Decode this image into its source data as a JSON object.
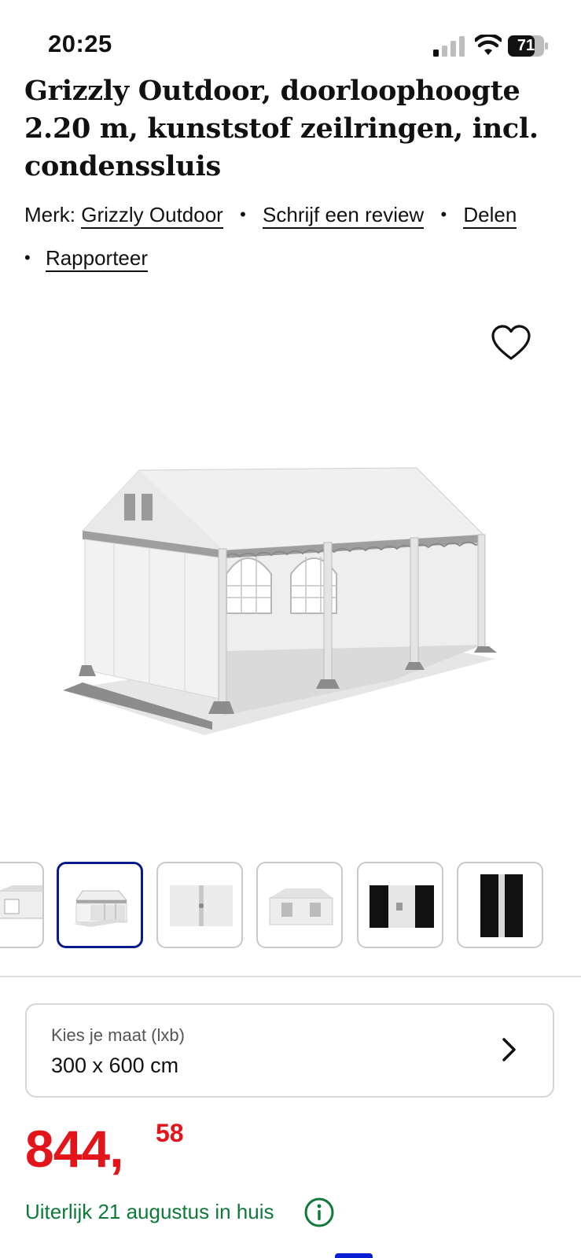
{
  "status_bar": {
    "time": "20:25",
    "battery": "71"
  },
  "product": {
    "title": "Grizzly Outdoor, doorloophoogte 2.20 m, kunststof zeilringen, incl. condenssluis",
    "brand_prefix": "Merk:",
    "brand": "Grizzly Outdoor",
    "write_review": "Schrijf een review",
    "share": "Delen",
    "report": "Rapporteer",
    "separator": "•"
  },
  "favorite_icon": "heart-outline-icon",
  "gallery": {
    "thumbnail_count": 6,
    "active_index": 1
  },
  "size_selector": {
    "label": "Kies je maat (lxb)",
    "value": "300 x 600 cm"
  },
  "price": {
    "euros": "844,",
    "cents": "58"
  },
  "delivery": {
    "text": "Uiterlijk 21 augustus in huis"
  },
  "colors": {
    "price": "#e4141b",
    "delivery": "#0e7a3a",
    "active_thumb": "#0a1a8c"
  }
}
